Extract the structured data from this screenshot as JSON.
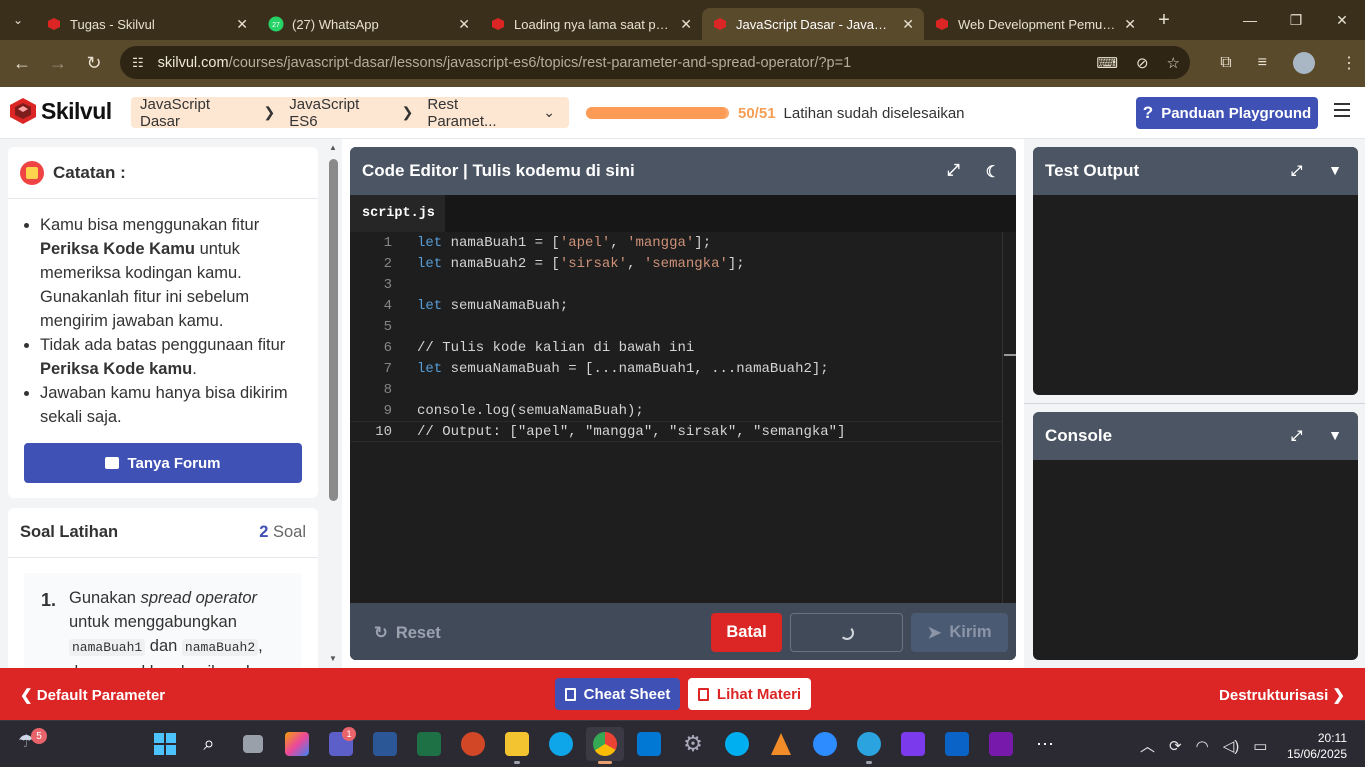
{
  "browser": {
    "tabs": [
      {
        "title": "Tugas - Skilvul",
        "favicon": "skilvul-icon",
        "color": "#dc2626"
      },
      {
        "title": "(27) WhatsApp",
        "favicon": "whatsapp-icon",
        "color": "#25d366"
      },
      {
        "title": "Loading nya lama saat perik",
        "favicon": "skilvul-icon",
        "color": "#dc2626"
      },
      {
        "title": "JavaScript Dasar - JavaScript",
        "favicon": "skilvul-icon",
        "color": "#dc2626",
        "active": true
      },
      {
        "title": "Web Development Pemula -",
        "favicon": "skilvul-icon",
        "color": "#dc2626"
      }
    ],
    "url_host": "skilvul.com",
    "url_path": "/courses/javascript-dasar/lessons/javascript-es6/topics/rest-parameter-and-spread-operator/?p=1"
  },
  "header": {
    "logo_text": "Skilvul",
    "breadcrumb": [
      "JavaScript Dasar",
      "JavaScript ES6",
      "Rest Paramet..."
    ],
    "progress_count": "50/51",
    "progress_fraction": 0.98,
    "progress_text": "Latihan sudah diselesaikan",
    "guide_button": "Panduan Playground",
    "accent": "#3f51b5",
    "progress_color": "#fb9b55"
  },
  "notes": {
    "title": "Catatan :",
    "items": [
      {
        "before": "Kamu bisa menggunakan fitur ",
        "bold": "Periksa Kode Kamu",
        "after": " untuk memeriksa kodingan kamu. Gunakanlah fitur ini sebelum mengirim jawaban kamu."
      },
      {
        "before": "Tidak ada batas penggunaan fitur ",
        "bold": "Periksa Kode kamu",
        "after": "."
      },
      {
        "before": "Jawaban kamu hanya bisa dikirim sekali saja.",
        "bold": "",
        "after": ""
      }
    ],
    "forum_button": "Tanya Forum"
  },
  "soal": {
    "title": "Soal Latihan",
    "count": "2",
    "count_label": "Soal",
    "item_number": "1.",
    "item_text_1": "Gunakan ",
    "item_text_em": "spread operator",
    "item_text_2": " untuk menggabungkan ",
    "code_1": "namaBuah1",
    "item_text_3": " dan ",
    "code_2": "namaBuah2",
    "item_text_4": ", dan masukkan hasilnya ke"
  },
  "editor": {
    "title": "Code Editor | Tulis kodemu di sini",
    "file_tab": "script.js",
    "lines": [
      "1",
      "2",
      "3",
      "4",
      "5",
      "6",
      "7",
      "8",
      "9",
      "10"
    ],
    "reset": "Reset",
    "cancel": "Batal",
    "submit": "Kirim"
  },
  "panels": {
    "test_output": "Test Output",
    "console": "Console"
  },
  "bottom": {
    "prev": "Default Parameter",
    "cheat": "Cheat Sheet",
    "materi": "Lihat Materi",
    "next": "Destrukturisasi"
  },
  "taskbar": {
    "weather_badge": "5",
    "teams_badge": "1",
    "time": "20:11",
    "date": "15/06/2025"
  }
}
